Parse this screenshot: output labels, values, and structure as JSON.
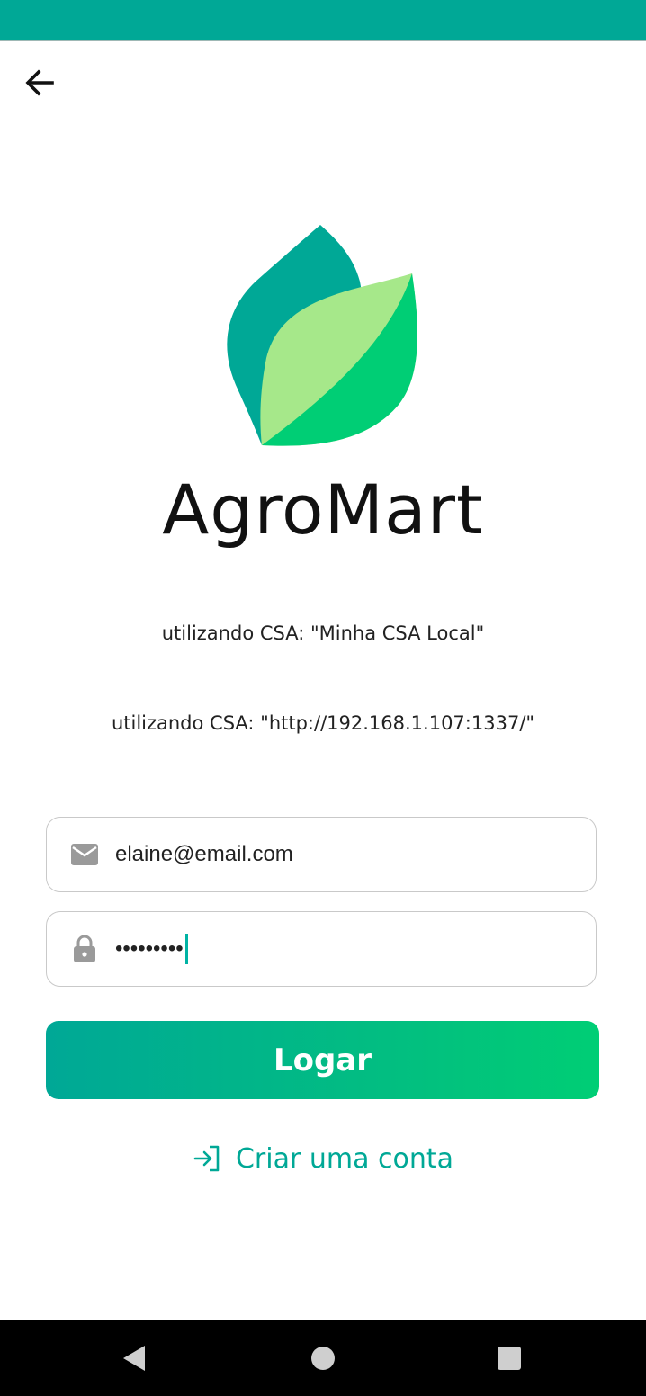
{
  "app": {
    "title": "AgroMart",
    "logo_icon": "leaf-logo",
    "brand_colors": {
      "teal": "#00A896",
      "green": "#00CE75",
      "light_green": "#A6E88A"
    }
  },
  "header": {
    "back_icon": "arrow-left-icon"
  },
  "csa": {
    "name_text": "utilizando CSA: \"Minha CSA Local\"",
    "url_text": "utilizando CSA: \"http://192.168.1.107:1337/\""
  },
  "form": {
    "email": {
      "icon": "mail-icon",
      "value": "elaine@email.com"
    },
    "password": {
      "icon": "lock-icon",
      "value": "•••••••••"
    },
    "login_label": "Logar",
    "create_account_icon": "login-arrow-icon",
    "create_account_label": "Criar uma conta"
  },
  "system_nav": {
    "back_icon": "nav-back-icon",
    "home_icon": "nav-home-icon",
    "recents_icon": "nav-recents-icon"
  }
}
